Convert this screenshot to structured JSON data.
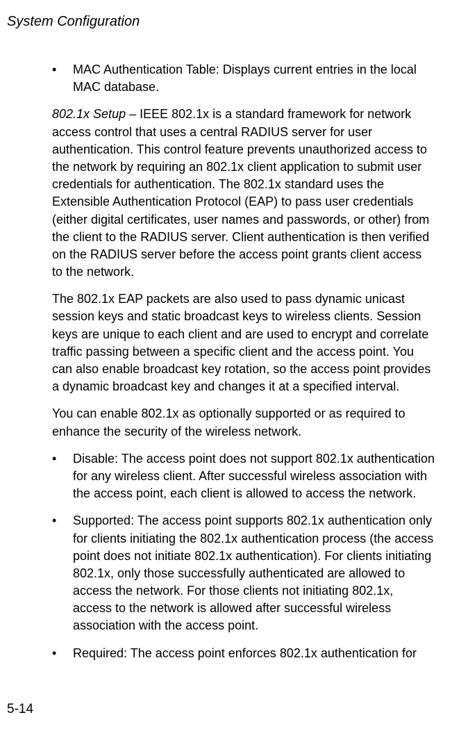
{
  "header": {
    "title": "System Configuration"
  },
  "content": {
    "bullet1": "MAC Authentication Table: Displays current entries in the local MAC database.",
    "setup_label": "802.1x Setup",
    "para1_rest": " – IEEE 802.1x is a standard framework for network access control that uses a central RADIUS server for user authentication. This control feature prevents unauthorized access to the network by requiring an 802.1x client application to submit user credentials for authentication. The 802.1x standard uses the Extensible Authentication Protocol (EAP) to pass user credentials (either digital certificates, user names and passwords, or other) from the client to the RADIUS server. Client authentication is then verified on the RADIUS server before the access point grants client access to the network.",
    "para2": "The 802.1x EAP packets are also used to pass dynamic unicast session keys and static broadcast keys to wireless clients. Session keys are unique to each client and are used to encrypt and correlate traffic passing between a specific client and the access point. You can also enable broadcast key rotation, so the access point provides a dynamic broadcast key and changes it at a specified interval.",
    "para3": "You can enable 802.1x as optionally supported or as required to enhance the security of the wireless network.",
    "bullet2": "Disable: The access point does not support 802.1x authentication for any wireless client. After successful wireless association with the access point, each client is allowed to access the network.",
    "bullet3": "Supported: The access point supports 802.1x authentication only for clients initiating the 802.1x authentication process (the access point does not initiate 802.1x authentication). For clients initiating 802.1x, only those successfully authenticated are allowed to access the network. For those clients not initiating 802.1x, access to the network is allowed after successful wireless association with the access point.",
    "bullet4": "Required: The access point enforces 802.1x authentication for"
  },
  "footer": {
    "page_number": "5-14"
  },
  "bullet_char": "•"
}
